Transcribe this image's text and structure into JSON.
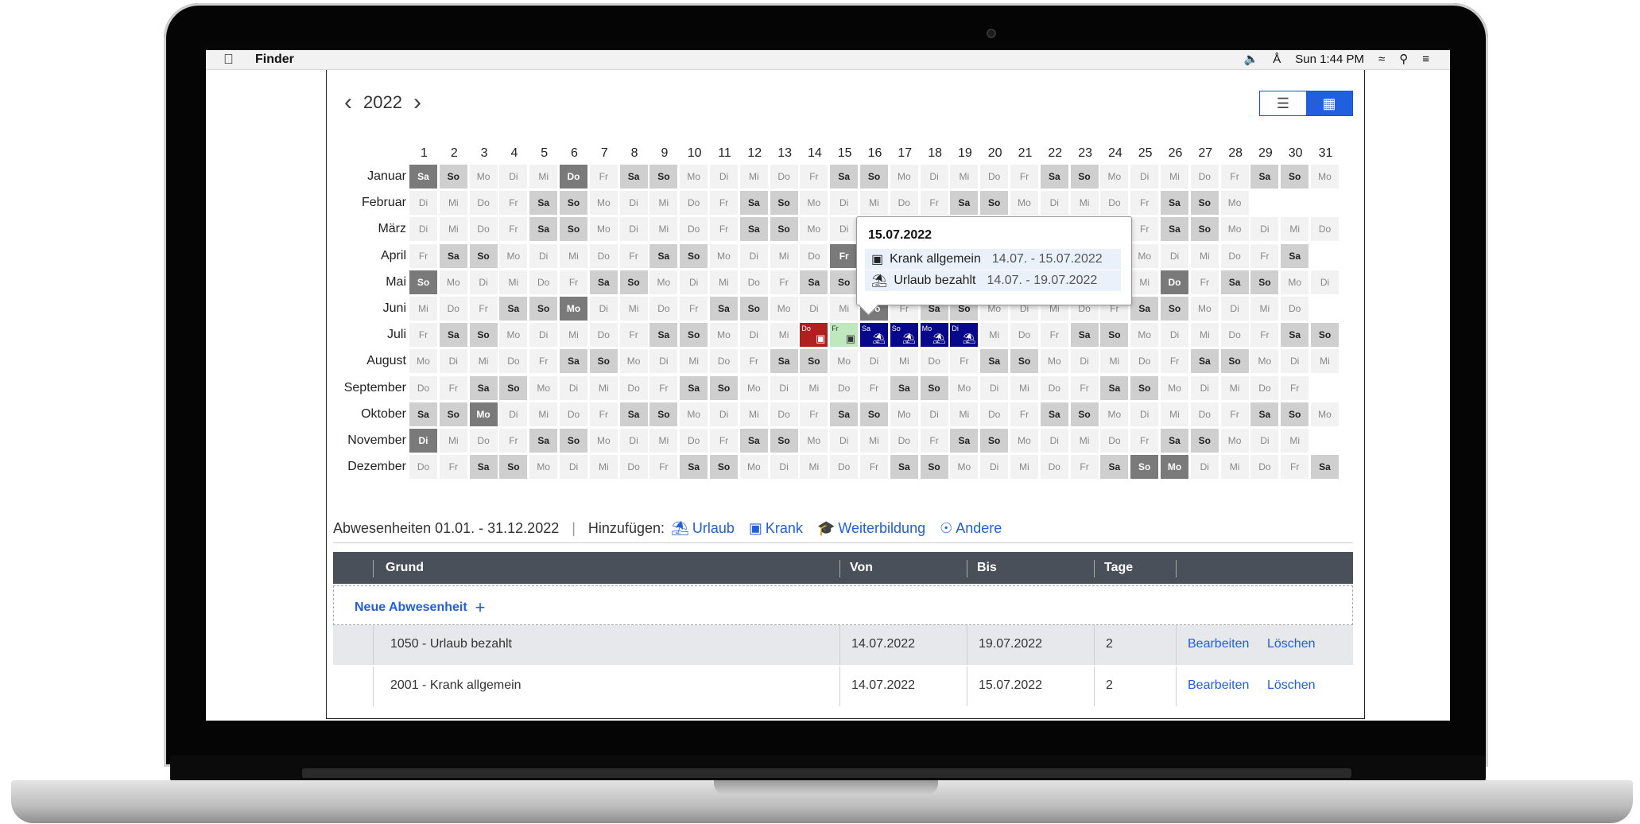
{
  "menubar": {
    "apple_icon": "apple-icon",
    "app_name": "Finder",
    "volume_icon": "volume-icon",
    "bluetooth_icon": "bluetooth-icon",
    "clock": "Sun 1:44 PM",
    "wifi_icon": "wifi-icon",
    "search_icon": "search-icon",
    "menu_icon": "list-menu-icon"
  },
  "year_nav": {
    "year": "2022"
  },
  "view_toggle": {
    "list_icon": "list-view-icon",
    "grid_icon": "grid-view-icon",
    "active": "grid"
  },
  "calendar": {
    "day_numbers": [
      "1",
      "2",
      "3",
      "4",
      "5",
      "6",
      "7",
      "8",
      "9",
      "10",
      "11",
      "12",
      "13",
      "14",
      "15",
      "16",
      "17",
      "18",
      "19",
      "20",
      "21",
      "22",
      "23",
      "24",
      "25",
      "26",
      "27",
      "28",
      "29",
      "30",
      "31"
    ],
    "months": [
      {
        "name": "Januar",
        "start": 5,
        "days": 31,
        "holidays": [
          1,
          6
        ]
      },
      {
        "name": "Februar",
        "start": 1,
        "days": 28,
        "holidays": []
      },
      {
        "name": "März",
        "start": 1,
        "days": 31,
        "holidays": []
      },
      {
        "name": "April",
        "start": 4,
        "days": 30,
        "holidays": [
          15,
          18
        ]
      },
      {
        "name": "Mai",
        "start": 6,
        "days": 31,
        "holidays": [
          1,
          26
        ]
      },
      {
        "name": "Juni",
        "start": 2,
        "days": 30,
        "holidays": [
          6,
          16
        ]
      },
      {
        "name": "Juli",
        "start": 4,
        "days": 31,
        "holidays": []
      },
      {
        "name": "August",
        "start": 0,
        "days": 31,
        "holidays": []
      },
      {
        "name": "September",
        "start": 3,
        "days": 30,
        "holidays": []
      },
      {
        "name": "Oktober",
        "start": 5,
        "days": 31,
        "holidays": [
          3
        ]
      },
      {
        "name": "November",
        "start": 1,
        "days": 30,
        "holidays": [
          1
        ]
      },
      {
        "name": "Dezember",
        "start": 3,
        "days": 31,
        "holidays": [
          25,
          26
        ]
      }
    ],
    "weekday_abbr": [
      "Mo",
      "Di",
      "Mi",
      "Do",
      "Fr",
      "Sa",
      "So"
    ],
    "absences": [
      {
        "month": 6,
        "day": 14,
        "type": "sick"
      },
      {
        "month": 6,
        "day": 15,
        "type": "sickpart"
      },
      {
        "month": 6,
        "day": 16,
        "type": "vacation"
      },
      {
        "month": 6,
        "day": 17,
        "type": "vacation"
      },
      {
        "month": 6,
        "day": 18,
        "type": "vacation"
      },
      {
        "month": 6,
        "day": 19,
        "type": "vacation"
      }
    ],
    "colors": {
      "weekend": "#cfcfcf",
      "holiday": "#7a7a7a",
      "sick": "#b21f1f",
      "sickpart": "#bfe8bf",
      "vacation": "#08088a",
      "weekday": "#f2f2f2"
    }
  },
  "tooltip": {
    "date": "15.07.2022",
    "entries": [
      {
        "icon": "medical-bag-icon",
        "label": "Krank allgemein",
        "range": "14.07. - 15.07.2022"
      },
      {
        "icon": "beach-umbrella-icon",
        "label": "Urlaub bezahlt",
        "range": "14.07. - 19.07.2022"
      }
    ]
  },
  "summary": {
    "period": "Abwesenheiten 01.01. - 31.12.2022",
    "add_label": "Hinzufügen:",
    "add_urlaub": "Urlaub",
    "add_krank": "Krank",
    "add_weiterbildung": "Weiterbildung",
    "add_andere": "Andere"
  },
  "table": {
    "headers": {
      "grund": "Grund",
      "von": "Von",
      "bis": "Bis",
      "tage": "Tage"
    },
    "new_label": "Neue Abwesenheit",
    "rows": [
      {
        "grund": "1050 - Urlaub bezahlt",
        "von": "14.07.2022",
        "bis": "19.07.2022",
        "tage": "2",
        "edit": "Bearbeiten",
        "delete": "Löschen"
      },
      {
        "grund": "2001 - Krank allgemein",
        "von": "14.07.2022",
        "bis": "15.07.2022",
        "tage": "2",
        "edit": "Bearbeiten",
        "delete": "Löschen"
      }
    ]
  }
}
